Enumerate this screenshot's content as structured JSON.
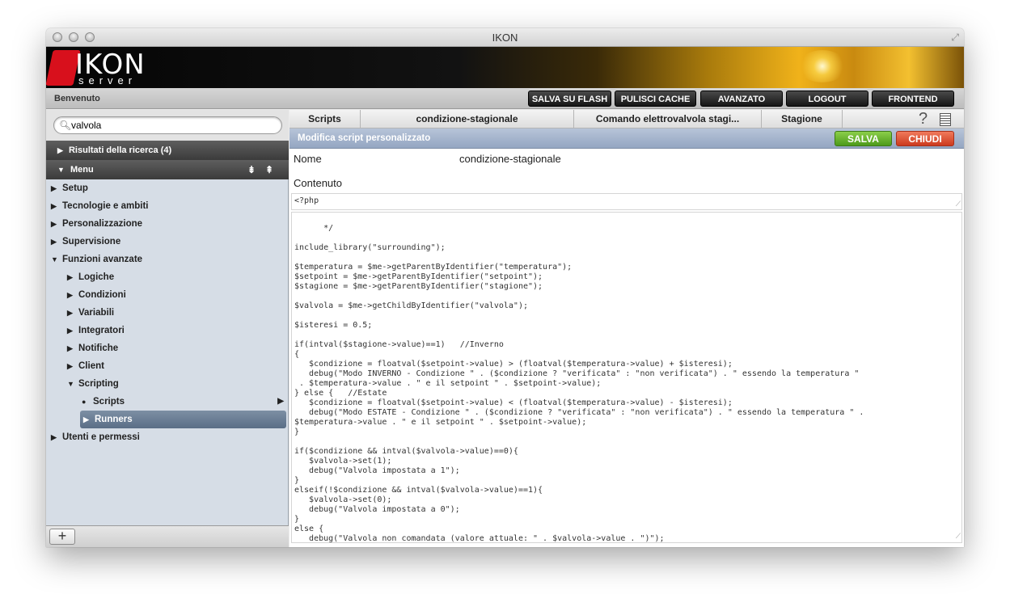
{
  "window": {
    "title": "IKON"
  },
  "banner": {
    "logo_main": "IKON",
    "logo_sub": "server"
  },
  "toolbar": {
    "welcome": "Benvenuto",
    "buttons": [
      "SALVA SU FLASH",
      "PULISCI CACHE",
      "AVANZATO",
      "LOGOUT",
      "FRONTEND"
    ]
  },
  "search": {
    "value": "valvola",
    "placeholder": ""
  },
  "sidebar": {
    "results_label": "Risultati della ricerca (4)",
    "menu_label": "Menu",
    "items": [
      {
        "label": "Setup"
      },
      {
        "label": "Tecnologie e ambiti"
      },
      {
        "label": "Personalizzazione"
      },
      {
        "label": "Supervisione"
      },
      {
        "label": "Funzioni avanzate"
      },
      {
        "label": "Logiche"
      },
      {
        "label": "Condizioni"
      },
      {
        "label": "Variabili"
      },
      {
        "label": "Integratori"
      },
      {
        "label": "Notifiche"
      },
      {
        "label": "Client"
      },
      {
        "label": "Scripting"
      },
      {
        "label": "Scripts"
      },
      {
        "label": "Runners"
      },
      {
        "label": "Utenti e permessi"
      }
    ],
    "add_label": "+"
  },
  "breadcrumb": [
    "Scripts",
    "condizione-stagionale",
    "Comando elettrovalvola stagi...",
    "Stagione"
  ],
  "help_label": "?",
  "panel": {
    "title": "Modifica script personalizzato",
    "save_label": "SALVA",
    "close_label": "CHIUDI"
  },
  "form": {
    "name_label": "Nome",
    "name_value": "condizione-stagionale",
    "content_label": "Contenuto",
    "code_header": "<?php",
    "code": "*/\n\ninclude_library(\"surrounding\");\n\n$temperatura = $me->getParentByIdentifier(\"temperatura\");\n$setpoint = $me->getParentByIdentifier(\"setpoint\");\n$stagione = $me->getParentByIdentifier(\"stagione\");\n\n$valvola = $me->getChildByIdentifier(\"valvola\");\n\n$isteresi = 0.5;\n\nif(intval($stagione->value)==1)   //Inverno\n{\n   $condizione = floatval($setpoint->value) > (floatval($temperatura->value) + $isteresi);\n   debug(\"Modo INVERNO - Condizione \" . ($condizione ? \"verificata\" : \"non verificata\") . \" essendo la temperatura \"\n . $temperatura->value . \" e il setpoint \" . $setpoint->value);\n} else {   //Estate\n   $condizione = floatval($setpoint->value) < (floatval($temperatura->value) - $isteresi);\n   debug(\"Modo ESTATE - Condizione \" . ($condizione ? \"verificata\" : \"non verificata\") . \" essendo la temperatura \" .\n$temperatura->value . \" e il setpoint \" . $setpoint->value);\n}\n\nif($condizione && intval($valvola->value)==0){\n   $valvola->set(1);\n   debug(\"Valvola impostata a 1\");\n}\nelseif(!$condizione && intval($valvola->value)==1){\n   $valvola->set(0);\n   debug(\"Valvola impostata a 0\");\n}\nelse {\n   debug(\"Valvola non comandata (valore attuale: \" . $valvola->value . \")\");\n}"
  }
}
